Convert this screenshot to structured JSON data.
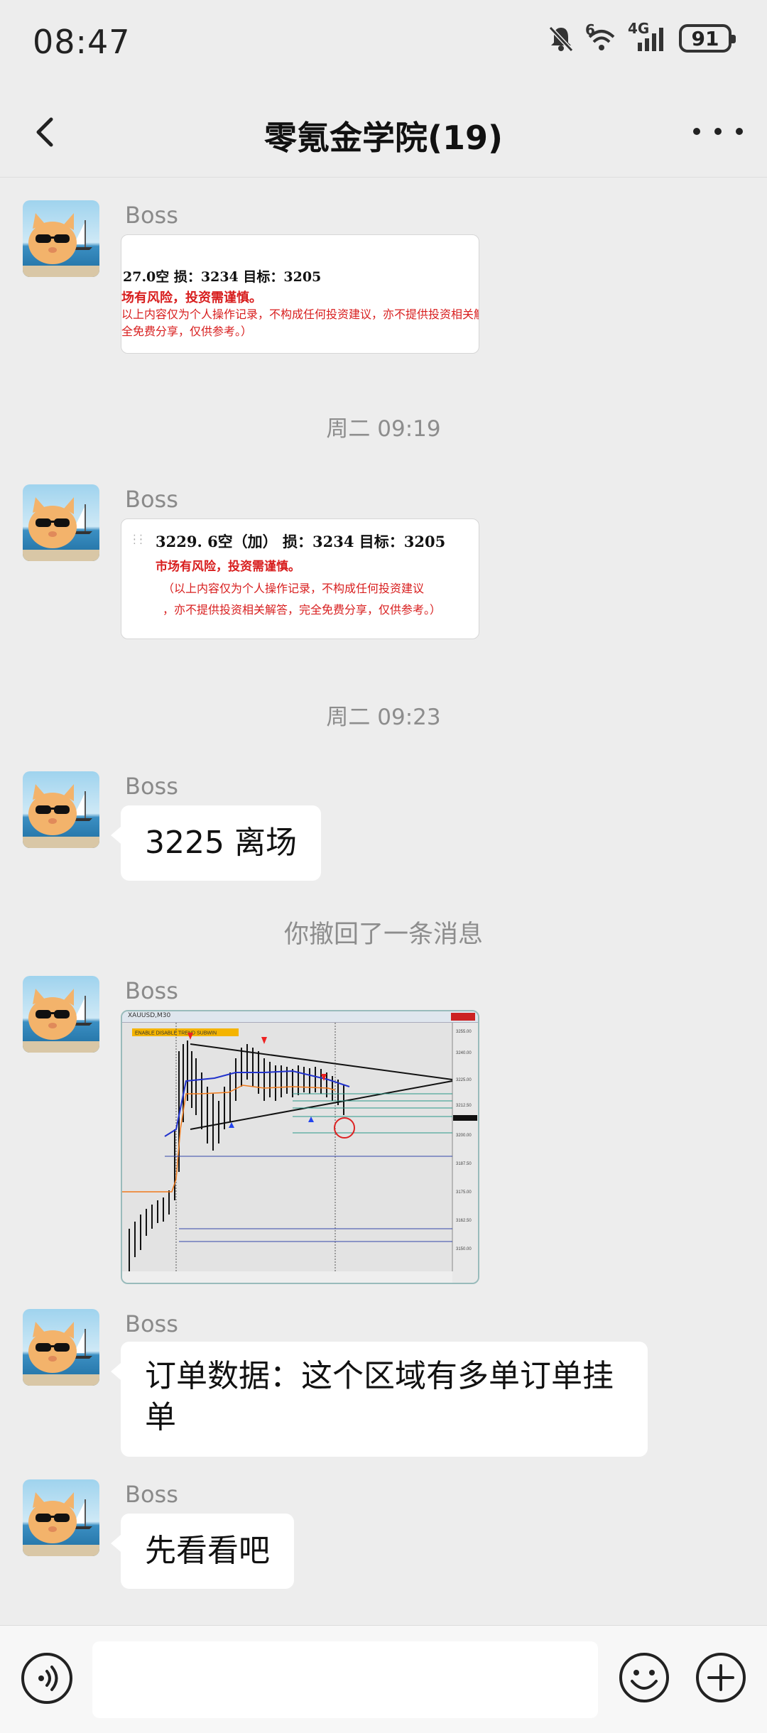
{
  "status": {
    "time": "08:47",
    "battery": "91",
    "network": "4G",
    "wifi_tag": "6"
  },
  "nav": {
    "title": "零氪金学院(19)"
  },
  "messages": {
    "m1": {
      "sender": "Boss",
      "card": {
        "line1": "27.0空   损：3234  目标：3205",
        "line2": "场有风险，投资需谨慎。",
        "line3": "以上内容仅为个人操作记录，不构成任何投资建议，亦不提供投资相关解答",
        "line4": "全免费分享，仅供参考。）"
      }
    },
    "sep1": "周二 09:19",
    "m2": {
      "sender": "Boss",
      "card": {
        "line1": "3229. 6空（加）   损：3234  目标：3205",
        "line2": "市场有风险，投资需谨慎。",
        "line3": "（以上内容仅为个人操作记录，不构成任何投资建议",
        "line4": "，亦不提供投资相关解答，完全免费分享，仅供参考。）"
      }
    },
    "sep2": "周二 09:23",
    "m3": {
      "sender": "Boss",
      "text": "3225 离场"
    },
    "recall": "你撤回了一条消息",
    "m4": {
      "sender": "Boss",
      "chart_window": {
        "title": "XAUUSD,M30",
        "label": "ENABLE DISABLE TREND SUBWIN"
      }
    },
    "m5": {
      "sender": "Boss",
      "text_line1": "订单数据：这个区域有多单订单挂",
      "text_line2": "单"
    },
    "m6": {
      "sender": "Boss",
      "text": "先看看吧"
    }
  },
  "input": {
    "placeholder": ""
  },
  "colors": {
    "bg": "#ededed",
    "bubble": "#ffffff",
    "card_red": "#d81e1e",
    "time_gray": "#8d8d8d"
  },
  "icons": [
    "back-arrow-icon",
    "more-icon",
    "mute-bell-icon",
    "wifi-icon",
    "signal-icon",
    "battery-icon",
    "voice-icon",
    "emoji-icon",
    "plus-icon"
  ]
}
